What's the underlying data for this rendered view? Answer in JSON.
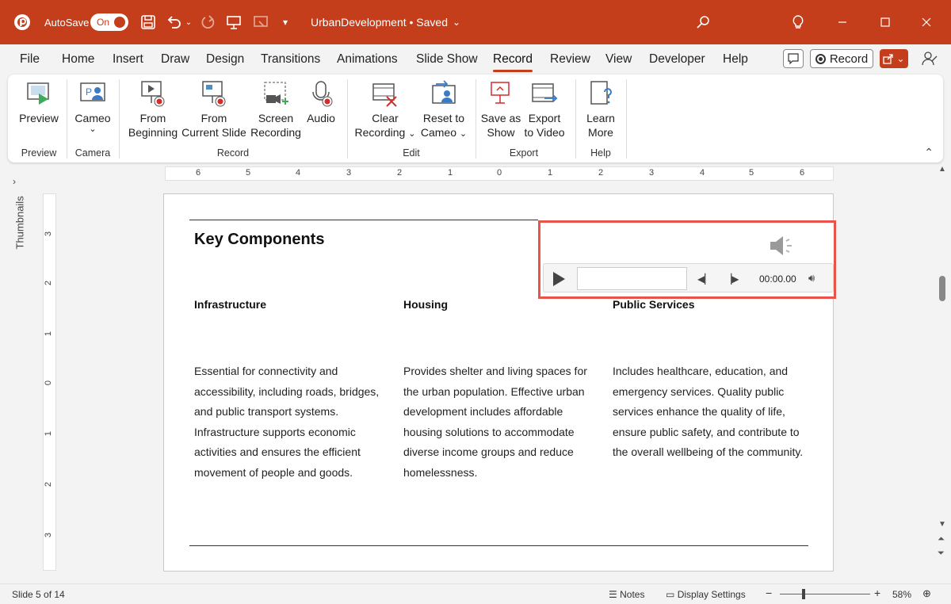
{
  "app": {
    "autosave_label": "AutoSave",
    "autosave_state": "On",
    "doc_title": "UrbanDevelopment • Saved",
    "brand_color": "#c43e1c"
  },
  "menu": {
    "tabs": [
      "File",
      "Home",
      "Insert",
      "Draw",
      "Design",
      "Transitions",
      "Animations",
      "Slide Show",
      "Record",
      "Review",
      "View",
      "Developer",
      "Help"
    ],
    "active_tab": "Record",
    "record_button": "Record"
  },
  "ribbon": {
    "preview": {
      "label": "Preview",
      "group": "Preview"
    },
    "cameo": {
      "label": "Cameo",
      "group": "Camera"
    },
    "from_beginning": {
      "line1": "From",
      "line2": "Beginning"
    },
    "from_current": {
      "line1": "From",
      "line2": "Current Slide"
    },
    "screen_recording": {
      "line1": "Screen",
      "line2": "Recording"
    },
    "audio": {
      "label": "Audio"
    },
    "record_group": "Record",
    "clear_recording": {
      "line1": "Clear",
      "line2": "Recording"
    },
    "reset_cameo": {
      "line1": "Reset to",
      "line2": "Cameo"
    },
    "edit_group": "Edit",
    "save_as_show": {
      "line1": "Save as",
      "line2": "Show"
    },
    "export_video": {
      "line1": "Export",
      "line2": "to Video"
    },
    "export_group": "Export",
    "learn_more": {
      "line1": "Learn",
      "line2": "More"
    },
    "help_group": "Help"
  },
  "rulers": {
    "horizontal": [
      "6",
      "5",
      "4",
      "3",
      "2",
      "1",
      "0",
      "1",
      "2",
      "3",
      "4",
      "5",
      "6"
    ],
    "vertical": [
      "3",
      "2",
      "1",
      "0",
      "1",
      "2",
      "3"
    ]
  },
  "thumbnails_label": "Thumbnails",
  "slide": {
    "title": "Key Components",
    "columns": [
      {
        "heading": "Infrastructure",
        "body": "Essential for connectivity and accessibility, including roads, bridges, and public transport systems. Infrastructure supports economic activities and ensures the efficient movement of people and goods."
      },
      {
        "heading": "Housing",
        "body": "Provides shelter and living spaces for the urban population. Effective urban development includes affordable housing solutions to accommodate diverse income groups and reduce homelessness."
      },
      {
        "heading": "Public Services",
        "body": "Includes healthcare, education, and emergency services. Quality public services enhance the quality of life, ensure public safety, and contribute to the overall wellbeing of the community."
      }
    ]
  },
  "audio_player": {
    "time": "00:00.00",
    "highlight_color": "#e8534a"
  },
  "status": {
    "slide_info": "Slide 5 of 14",
    "notes": "Notes",
    "display_settings": "Display Settings",
    "zoom": "58%",
    "zoom_minus": "−",
    "zoom_plus": "+"
  }
}
